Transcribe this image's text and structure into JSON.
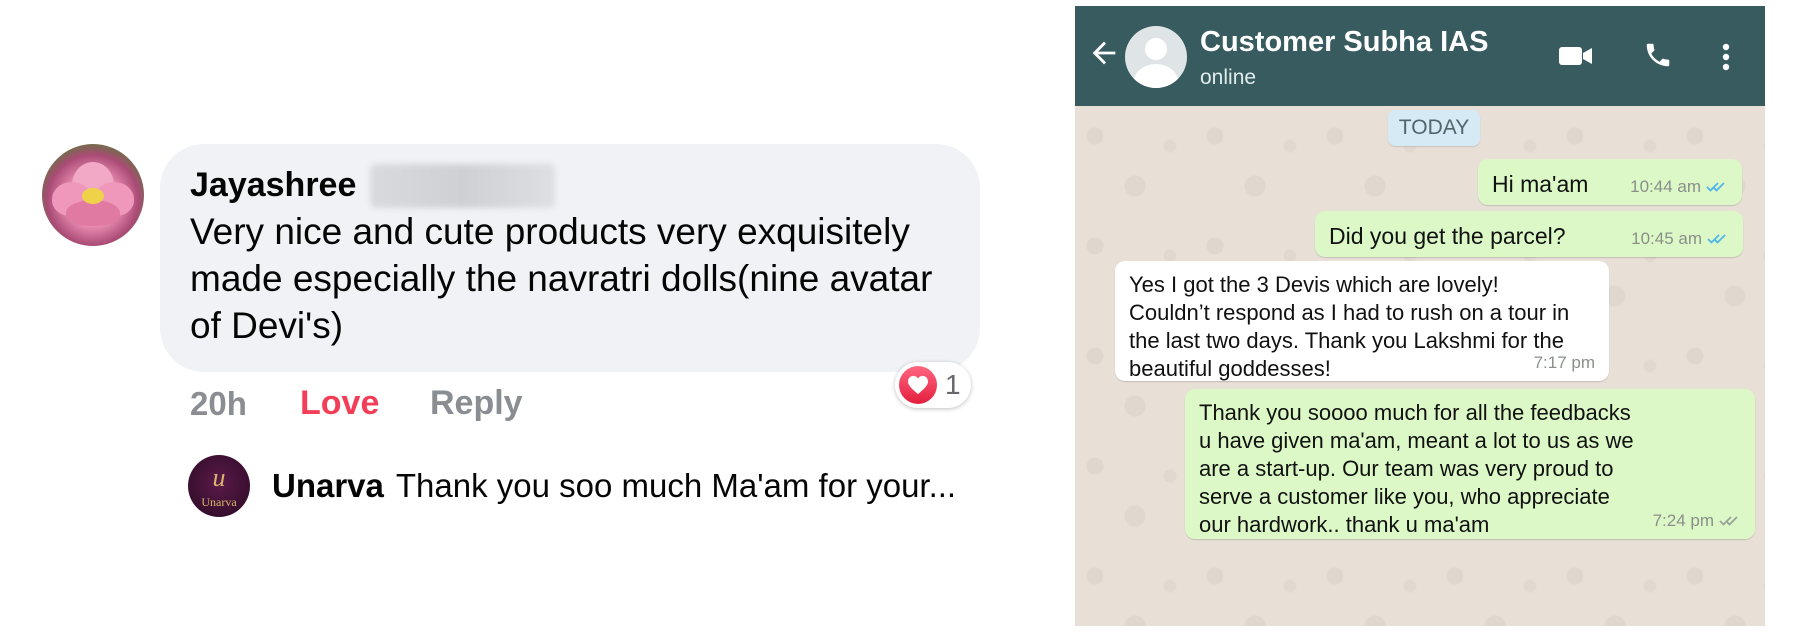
{
  "facebook": {
    "comment": {
      "author": "Jayashree",
      "text": "Very nice and cute products very exquisitely made especially the navratri dolls(nine avatar of Devi's)",
      "reaction_count": "1",
      "time": "20h",
      "love_label": "Love",
      "reply_label": "Reply"
    },
    "reply": {
      "logo_letter": "u",
      "logo_word": "Unarva",
      "author": "Unarva",
      "text": "Thank you soo much Ma'am for your..."
    }
  },
  "whatsapp": {
    "contact_name": "Customer Subha IAS",
    "status": "online",
    "date_divider": "TODAY",
    "messages": [
      {
        "direction": "out",
        "text": "Hi ma'am",
        "time": "10:44 am",
        "ticks": "read"
      },
      {
        "direction": "out",
        "text": "Did you get the parcel?",
        "time": "10:45 am",
        "ticks": "read"
      },
      {
        "direction": "in",
        "text": "Yes I got the 3 Devis which are lovely!\nCouldn’t respond as I had to rush on a tour in\nthe last two days. Thank you Lakshmi for the\nbeautiful goddesses!",
        "time": "7:17 pm"
      },
      {
        "direction": "out",
        "text": "Thank you soooo much for all the feedbacks\nu have given ma'am, meant a lot to us as we\nare a start-up.  Our team was very proud to\nserve a customer like you, who appreciate\nour hardwork.. thank u ma'am",
        "time": "7:24 pm",
        "ticks": "delivered"
      }
    ],
    "colors": {
      "header": "#385b5f",
      "outgoing_bubble": "#dcf8c6",
      "incoming_bubble": "#ffffff",
      "read_tick": "#4fb6ec"
    }
  },
  "icons": {
    "back": "arrow-left-icon",
    "video": "video-camera-icon",
    "call": "phone-icon",
    "more": "kebab-menu-icon",
    "reaction": "heart-icon"
  }
}
